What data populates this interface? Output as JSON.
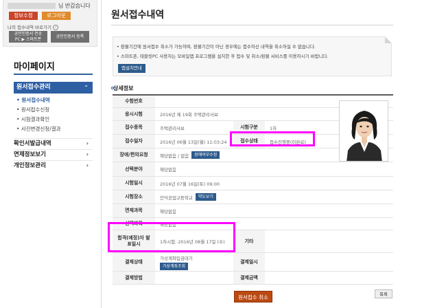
{
  "sidebar": {
    "greeting": "님 반갑습니다",
    "edit_info_label": "정보수정",
    "logout_label": "로그아웃",
    "my_history_label": "나의 접수내역 바로가기",
    "cert_transfer_label": "공인인증서 전송",
    "cert_transfer_sub": "PC ▶ 스마트폰",
    "cert_register_label": "공인인증서 등록",
    "mypage_title": "마이페이지",
    "active_category": "원서접수관리",
    "submenu": [
      "원서접수내역",
      "원서접수신청",
      "시험결과확인",
      "사진변경신청/결과"
    ],
    "categories": [
      "확인서발급내역",
      "면제정보보기",
      "개인정보관리"
    ]
  },
  "main": {
    "title": "원서접수내역",
    "notices": [
      "• 환불기간에 원서접수 취소가 가능하며, 환불기간이 아닌 경우에는 접수하신 내역을 취소하실 수 없습니다.",
      "• 스마트폰, 태블릿PC 사용자는 모바일앱 프로그램을 설치한 후 접수 및 취소/환불 서비스를 이용하시기 바랍니다."
    ],
    "app_guide_label": "앱설치안내",
    "section_title": "상세정보",
    "rows": {
      "exam_no": {
        "label": "수험번호",
        "value": ""
      },
      "exam_name": {
        "label": "응시시험",
        "value": "2016년 제 19회 주택관리사보"
      },
      "field": {
        "label": "접수종목",
        "value": "주택관리사보"
      },
      "grade": {
        "label": "시험구분",
        "value": "1차"
      },
      "date": {
        "label": "접수일자",
        "value": "2016년 06월 13일(월) 11:03:24"
      },
      "status": {
        "label": "접수상태",
        "value": "접수진행중(미완료)"
      },
      "disability": {
        "label": "장애/편의요청",
        "value": "해당없음 / 없음",
        "button": "장애여부수정"
      },
      "choice": {
        "label": "선택분야",
        "value": "해당없음"
      },
      "exam_date": {
        "label": "시험일시",
        "value": "2016년 07월 16일(토) 09:00"
      },
      "place": {
        "label": "시험장소",
        "value": "인덕공업고등학교",
        "button": "약도보기"
      },
      "exempt": {
        "label": "면제과목",
        "value": "해당없음"
      },
      "select_subject": {
        "label": "선택과목",
        "value": "해당없음"
      },
      "result": {
        "label": "합격(예정)자 발표일시",
        "value": "1차시험: 2016년 08월 17일 (수)",
        "other_label": "기타",
        "other_value": ""
      },
      "pay_status": {
        "label": "결제상태",
        "value": "가상계좌입금대기",
        "button": "가상계좌조회",
        "pay_date_label": "결제일시",
        "pay_date_value": ""
      },
      "pay_method": {
        "label": "결제방법",
        "value": "",
        "amount_label": "결제금액",
        "amount_value": ""
      }
    },
    "cancel_label": "원서접수 취소",
    "list_label": "목록"
  }
}
